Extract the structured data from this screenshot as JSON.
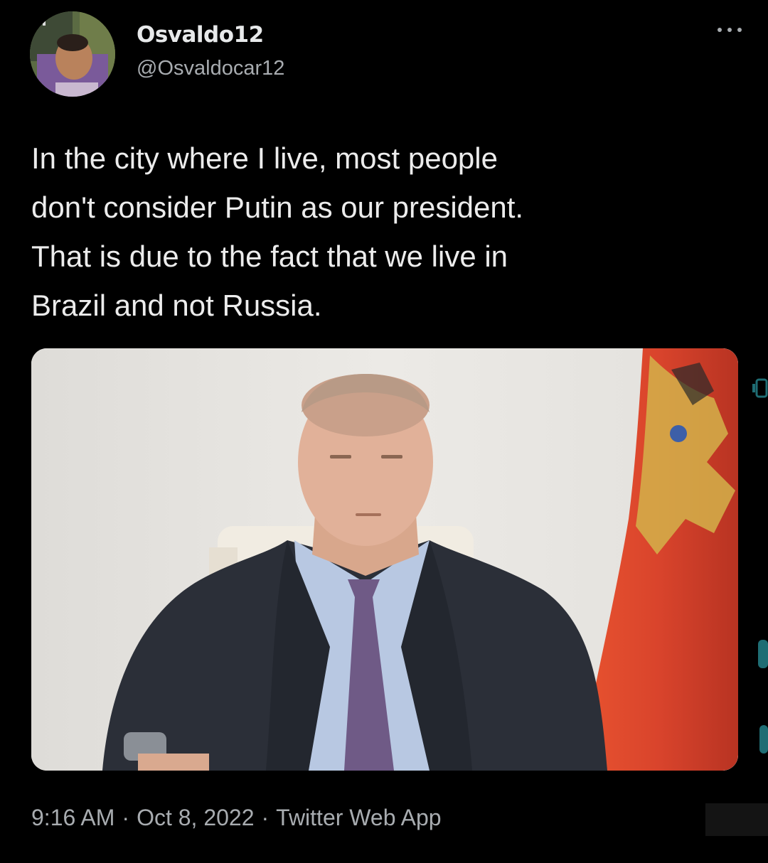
{
  "tweet": {
    "display_name": "Osvaldo12",
    "handle": "@Osvaldocar12",
    "more_icon": "more-horizontal-icon",
    "text": "In the city where I live, most people\ndon't consider Putin as our president.\nThat is due to the fact that we live in\nBrazil and not Russia.",
    "timestamp": {
      "time": "9:16 AM",
      "date": "Oct 8, 2022",
      "source": "Twitter Web App",
      "separator": "·"
    }
  },
  "colors": {
    "background": "#000000",
    "primary_text": "#e7e9ea",
    "secondary_text": "#a8acb0",
    "flag_red": "#d9442c"
  }
}
